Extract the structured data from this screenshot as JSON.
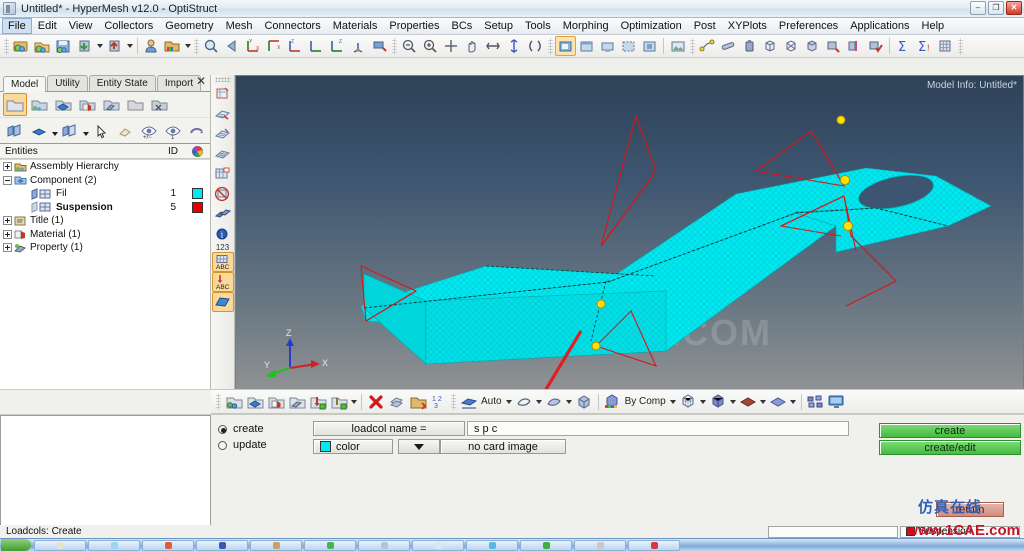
{
  "window": {
    "title": "Untitled* - HyperMesh v12.0 - OptiStruct",
    "icon": "hypermesh-icon",
    "minimize": "–",
    "maximize": "❐",
    "close": "✕"
  },
  "menubar": {
    "items": [
      {
        "label": "File",
        "active": true
      },
      {
        "label": "Edit",
        "active": false
      },
      {
        "label": "View",
        "active": false
      },
      {
        "label": "Collectors",
        "active": false
      },
      {
        "label": "Geometry",
        "active": false
      },
      {
        "label": "Mesh",
        "active": false
      },
      {
        "label": "Connectors",
        "active": false
      },
      {
        "label": "Materials",
        "active": false
      },
      {
        "label": "Properties",
        "active": false
      },
      {
        "label": "BCs",
        "active": false
      },
      {
        "label": "Setup",
        "active": false
      },
      {
        "label": "Tools",
        "active": false
      },
      {
        "label": "Morphing",
        "active": false
      },
      {
        "label": "Optimization",
        "active": false
      },
      {
        "label": "Post",
        "active": false
      },
      {
        "label": "XYPlots",
        "active": false
      },
      {
        "label": "Preferences",
        "active": false
      },
      {
        "label": "Applications",
        "active": false
      },
      {
        "label": "Help",
        "active": false
      }
    ]
  },
  "toolbar_top": {
    "groups": [
      {
        "name": "file",
        "buttons": [
          "open-model-icon",
          "import-model-icon",
          "save-model-icon",
          "export-green-icon",
          "export-red-icon",
          "user-profile-icon",
          "color-folder-icon"
        ]
      },
      {
        "name": "view-standard",
        "buttons": [
          "zoom-find-icon",
          "back-arrow-icon",
          "view-xy-icon",
          "view-yx-icon",
          "view-zx-icon",
          "view-zy-icon",
          "view-zy2-icon",
          "view-iso-icon",
          "isometric-flag-icon"
        ]
      },
      {
        "name": "zoom-pan",
        "buttons": [
          "zoom-out-icon",
          "zoom-in-icon",
          "fit-icon",
          "pan-hand-icon",
          "arrow-horizontal-icon",
          "arrow-vertical-icon",
          "rotate-icon"
        ]
      },
      {
        "name": "screen-capture",
        "buttons": [
          "capture-active-icon",
          "capture-window-icon",
          "capture-region-icon",
          "capture-dashed-icon",
          "capture-full-icon",
          "capture-image-icon"
        ]
      },
      {
        "name": "measure",
        "buttons": [
          "node-path-icon",
          "distance-icon",
          "mass-icon",
          "box-icon",
          "box-wire-icon",
          "box-solid-icon",
          "mesh-red-icon",
          "mesh-pink-icon",
          "mesh-check-icon",
          "sum-icon",
          "sum-alt-icon",
          "matrix-icon"
        ]
      }
    ]
  },
  "browser": {
    "tabs": [
      {
        "label": "Model",
        "active": true
      },
      {
        "label": "Utility",
        "active": false
      },
      {
        "label": "Entity State",
        "active": false
      },
      {
        "label": "Import",
        "active": false
      }
    ],
    "close_label": "✕",
    "icon_row_1": [
      "folder-plain-icon",
      "folder-share-icon",
      "folder-blue-icon",
      "folder-material-icon",
      "folder-property-icon",
      "folder-gray-icon",
      "folder-delete-icon"
    ],
    "icon_row_2": [
      "panels-icon",
      "blue-disc-icon",
      "panel-stack-icon",
      "cursor-arrow-icon",
      "eraser-icon",
      "eye-plusminus-icon",
      "eye-one-icon",
      "undo-curve-icon"
    ],
    "columns": {
      "entities": "Entities",
      "id": "ID",
      "color": "color-wheel-icon"
    },
    "tree": [
      {
        "label": "Assembly Hierarchy",
        "id": "",
        "color": "",
        "depth": 0,
        "expander": "plus",
        "icon": "assembly-icon",
        "bold": false
      },
      {
        "label": "Component (2)",
        "id": "",
        "color": "",
        "depth": 0,
        "expander": "minus",
        "icon": "component-folder-icon",
        "bold": false
      },
      {
        "label": "Fil",
        "id": "1",
        "color": "#00e8ef",
        "depth": 2,
        "expander": "",
        "icon": "component-icon",
        "bold": false
      },
      {
        "label": "Suspension",
        "id": "5",
        "color": "#e60000",
        "depth": 2,
        "expander": "",
        "icon": "component-icon",
        "bold": true
      },
      {
        "label": "Title (1)",
        "id": "",
        "color": "",
        "depth": 0,
        "expander": "plus",
        "icon": "title-icon",
        "bold": false
      },
      {
        "label": "Material (1)",
        "id": "",
        "color": "",
        "depth": 0,
        "expander": "plus",
        "icon": "material-icon",
        "bold": false
      },
      {
        "label": "Property (1)",
        "id": "",
        "color": "",
        "depth": 0,
        "expander": "plus",
        "icon": "property-icon",
        "bold": false
      }
    ]
  },
  "vtoolbar": {
    "buttons": [
      {
        "name": "node-edit-icon",
        "selected": false
      },
      {
        "name": "element-edit-icon",
        "selected": false
      },
      {
        "name": "mesh-edit-icon",
        "selected": false
      },
      {
        "name": "mesh-plain-icon",
        "selected": false
      },
      {
        "name": "mesh-window-icon",
        "selected": false
      },
      {
        "name": "mesh-forbidden-icon",
        "selected": false
      },
      {
        "name": "normals-icon",
        "selected": false
      },
      {
        "name": "info-icon",
        "selected": false
      },
      {
        "name": "numbers-123-icon",
        "selected": false
      },
      {
        "name": "mesh-abc-icon",
        "selected": true
      },
      {
        "name": "load-abc-icon",
        "selected": true
      },
      {
        "name": "surface-icon",
        "selected": true
      }
    ]
  },
  "viewport": {
    "model_info": "Model Info: Untitled*",
    "watermark": "1CAE.COM",
    "axes": {
      "x": "X",
      "y": "Y",
      "z": "Z"
    },
    "mesh_color": "#00e8ef",
    "load_color": "#d81616",
    "node_color": "#ffe000"
  },
  "panel_toolbar": {
    "buttons": [
      "collector-multi-icon",
      "collector-blue-icon",
      "collector-material-icon",
      "collector-property-icon",
      "collector-load-icon",
      "collector-load2-icon",
      "delete-x-icon",
      "organize-icon",
      "renumber-icon",
      "count-123-icon"
    ],
    "auto_label": "Auto",
    "by_comp_label": "By Comp",
    "shade_buttons": [
      "wire-icon",
      "hidden-line-icon",
      "shaded-icon"
    ],
    "display_buttons": [
      "mesh-lines-icon",
      "mesh-shaded-icon",
      "surface-red-icon",
      "surface-blue-icon"
    ],
    "right_buttons": [
      "nodes-scatter-icon",
      "monitor-icon"
    ]
  },
  "command_panel": {
    "radio_create": "create",
    "radio_update": "update",
    "radio_selected": "create",
    "label_loadcol_name": "loadcol name =",
    "value_loadcol_name": "s p c",
    "color_label": "color",
    "color_value": "#00e8ef",
    "card_image_label": "no card image",
    "button_create": "create",
    "button_create_edit": "create/edit",
    "button_return": "return",
    "watermark_cn": "仿真在线"
  },
  "statusbar": {
    "message": "Loadcols: Create",
    "component_name": "Suspension",
    "component_color": "#e60000",
    "watermark_url": "www.1CAE.com"
  },
  "taskbar": {
    "start_label": "",
    "items": [
      {
        "color": "#e8e0d0"
      },
      {
        "color": "#9fd4f2"
      },
      {
        "color": "#e05b3c"
      },
      {
        "color": "#3a57b8"
      },
      {
        "color": "#c8a068"
      },
      {
        "color": "#4cb24c"
      },
      {
        "color": "#a8c8e0"
      },
      {
        "color": "#dde6ee"
      },
      {
        "color": "#57b8e0"
      },
      {
        "color": "#3fae3f"
      },
      {
        "color": "#c9c9c9"
      },
      {
        "color": "#d63a3a"
      }
    ]
  }
}
